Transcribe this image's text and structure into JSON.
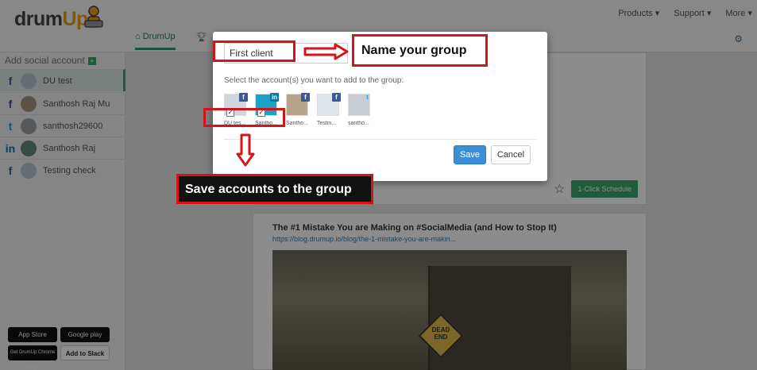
{
  "topbar": {
    "logo": {
      "text_a": "drum",
      "text_b": "Up"
    },
    "nav": [
      "Products ▾",
      "Support ▾",
      "More ▾"
    ],
    "tabs": [
      {
        "label": "DrumUp"
      },
      {
        "label": ""
      }
    ]
  },
  "sidebar": {
    "add_label": "Add social account",
    "accounts": [
      {
        "network": "f",
        "label": "DU test"
      },
      {
        "network": "f",
        "label": "Santhosh Raj Mu"
      },
      {
        "network": "t",
        "label": "santhosh29600"
      },
      {
        "network": "in",
        "label": "Santhosh Raj"
      },
      {
        "network": "f",
        "label": "Testing check"
      }
    ],
    "badges": [
      "App Store",
      "Google play",
      "Get DrumUp Chrome Plugin",
      "Add to Slack"
    ]
  },
  "feed": {
    "schedule_label": "1-Click Schedule",
    "article_title": "The #1 Mistake You are Making on #SocialMedia (and How to Stop It)",
    "article_link": "https://blog.drumup.io/blog/the-1-mistake-you-are-makin...",
    "sign_line1": "DEAD",
    "sign_line2": "END"
  },
  "modal": {
    "group_name_value": "First client",
    "select_label": "Select the account(s) you want to add to the group:",
    "accounts": [
      {
        "net": "f",
        "name": "DU tes..."
      },
      {
        "net": "in",
        "name": "Santho..."
      },
      {
        "net": "f",
        "name": "Santho..."
      },
      {
        "net": "f",
        "name": "Testin..."
      },
      {
        "net": "t",
        "name": "santho..."
      }
    ],
    "save_label": "Save",
    "cancel_label": "Cancel"
  },
  "annotations": {
    "name_group": "Name your group",
    "save_accounts": "Save accounts to the group"
  },
  "colors": {
    "accent_green": "#3aa76d",
    "annotation_red": "#d0161a",
    "save_blue": "#3a8fd9"
  }
}
